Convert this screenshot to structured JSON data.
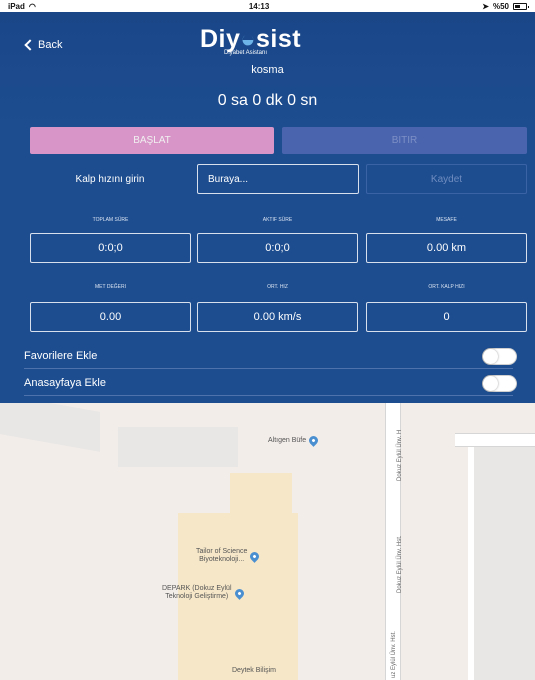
{
  "status_bar": {
    "device": "iPad",
    "wifi_icon": "wifi-icon",
    "time": "14:13",
    "battery": "%50",
    "location_icon": "location-arrow-icon"
  },
  "nav": {
    "back_label": "Back"
  },
  "logo": {
    "brand_prefix": "Diy",
    "brand_suffix": "sist",
    "subtitle": "Diyabet Asistanı"
  },
  "activity": {
    "name": "kosma",
    "elapsed": "0 sa 0 dk 0 sn"
  },
  "actions": {
    "start_label": "BAŞLAT",
    "stop_label": "BITIR"
  },
  "heart_rate": {
    "label": "Kalp hızını girin",
    "placeholder": "Buraya...",
    "save_label": "Kaydet"
  },
  "stats": {
    "row1": [
      {
        "label": "TOPLAM SÜRE",
        "value": "0:0;0"
      },
      {
        "label": "AKTIF SÜRE",
        "value": "0:0;0"
      },
      {
        "label": "MESAFE",
        "value": "0.00 km"
      }
    ],
    "row2": [
      {
        "label": "MET DEĞERI",
        "value": "0.00"
      },
      {
        "label": "ORT. HIZ",
        "value": "0.00 km/s"
      },
      {
        "label": "ORT. KALP HIZI",
        "value": "0"
      }
    ]
  },
  "toggles": {
    "favorites_label": "Favorilere Ekle",
    "homepage_label": "Anasayfaya Ekle"
  },
  "map": {
    "poi_1": "Altıgen Büfe",
    "poi_2_line1": "Tailor of Science",
    "poi_2_line2": "Biyoteknoloji...",
    "poi_3_line1": "DEPARK (Dokuz Eylül",
    "poi_3_line2": "Teknoloji Geliştirme)",
    "poi_4": "Deytek Bilişim",
    "road_1": "Dokuz Eylül Ünv. H",
    "road_2": "Dokuz Eylül Ünv. Hst.",
    "road_3": "uz Eylül Ünv. Hst."
  },
  "colors": {
    "primary": "#1d4d8f",
    "start_button": "#d896c8",
    "stop_button": "#4a65ae",
    "map_bg": "#f3edea"
  }
}
